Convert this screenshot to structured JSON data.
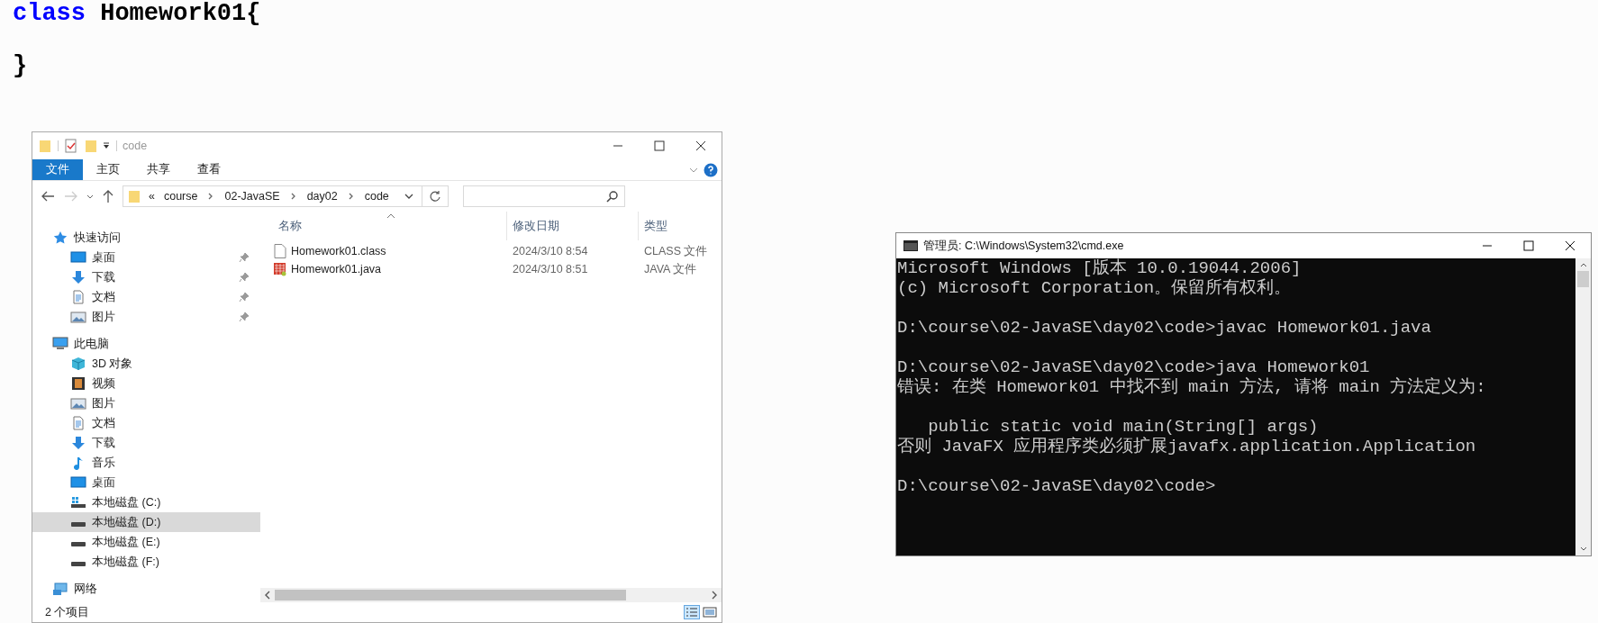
{
  "code_editor": {
    "lines": [
      {
        "keyword": "class",
        "text": "Homework01{"
      },
      {
        "text": "}"
      }
    ]
  },
  "file_explorer": {
    "title": "code",
    "ribbon_tabs": [
      {
        "label": "文件",
        "selected": true
      },
      {
        "label": "主页",
        "selected": false
      },
      {
        "label": "共享",
        "selected": false
      },
      {
        "label": "查看",
        "selected": false
      }
    ],
    "address_path": {
      "overflow": "«",
      "segments": [
        "course",
        "02-JavaSE",
        "day02",
        "code"
      ]
    },
    "navigation": [
      {
        "label": "快速访问",
        "kind": "star",
        "selected": false,
        "children": [
          {
            "label": "桌面",
            "kind": "desktop",
            "pinned": true,
            "selected": false
          },
          {
            "label": "下载",
            "kind": "download",
            "pinned": true,
            "selected": false
          },
          {
            "label": "文档",
            "kind": "document",
            "pinned": true,
            "selected": false
          },
          {
            "label": "图片",
            "kind": "picture",
            "pinned": true,
            "selected": false
          }
        ]
      },
      {
        "label": "此电脑",
        "kind": "pc",
        "selected": false,
        "children": [
          {
            "label": "3D 对象",
            "kind": "cube",
            "pinned": false,
            "selected": false
          },
          {
            "label": "视频",
            "kind": "video",
            "pinned": false,
            "selected": false
          },
          {
            "label": "图片",
            "kind": "picture",
            "pinned": false,
            "selected": false
          },
          {
            "label": "文档",
            "kind": "document",
            "pinned": false,
            "selected": false
          },
          {
            "label": "下载",
            "kind": "download",
            "pinned": false,
            "selected": false
          },
          {
            "label": "音乐",
            "kind": "music",
            "pinned": false,
            "selected": false
          },
          {
            "label": "桌面",
            "kind": "desktop",
            "pinned": false,
            "selected": false
          },
          {
            "label": "本地磁盘 (C:)",
            "kind": "system-drive",
            "pinned": false,
            "selected": false
          },
          {
            "label": "本地磁盘 (D:)",
            "kind": "drive",
            "pinned": false,
            "selected": true
          },
          {
            "label": "本地磁盘 (E:)",
            "kind": "drive",
            "pinned": false,
            "selected": false
          },
          {
            "label": "本地磁盘 (F:)",
            "kind": "drive",
            "pinned": false,
            "selected": false
          }
        ]
      },
      {
        "label": "网络",
        "kind": "network",
        "selected": false
      }
    ],
    "columns": [
      "名称",
      "修改日期",
      "类型"
    ],
    "files": [
      {
        "name": "Homework01.class",
        "modified": "2024/3/10 8:54",
        "type": "CLASS 文件",
        "kind": "class"
      },
      {
        "name": "Homework01.java",
        "modified": "2024/3/10 8:51",
        "type": "JAVA 文件",
        "kind": "java"
      }
    ],
    "status_bar": "2 个项目"
  },
  "command_prompt": {
    "title": "管理员: C:\\Windows\\System32\\cmd.exe",
    "blocks": [
      [
        "Microsoft Windows [版本 10.0.19044.2006]",
        "(c) Microsoft Corporation。保留所有权利。"
      ],
      [
        "D:\\course\\02-JavaSE\\day02\\code>javac Homework01.java"
      ],
      [
        "D:\\course\\02-JavaSE\\day02\\code>java Homework01",
        "错误: 在类 Homework01 中找不到 main 方法, 请将 main 方法定义为:"
      ],
      [
        "   public static void main(String[] args)",
        "否则 JavaFX 应用程序类必须扩展javafx.application.Application"
      ],
      [
        "D:\\course\\02-JavaSE\\day02\\code>"
      ]
    ]
  }
}
